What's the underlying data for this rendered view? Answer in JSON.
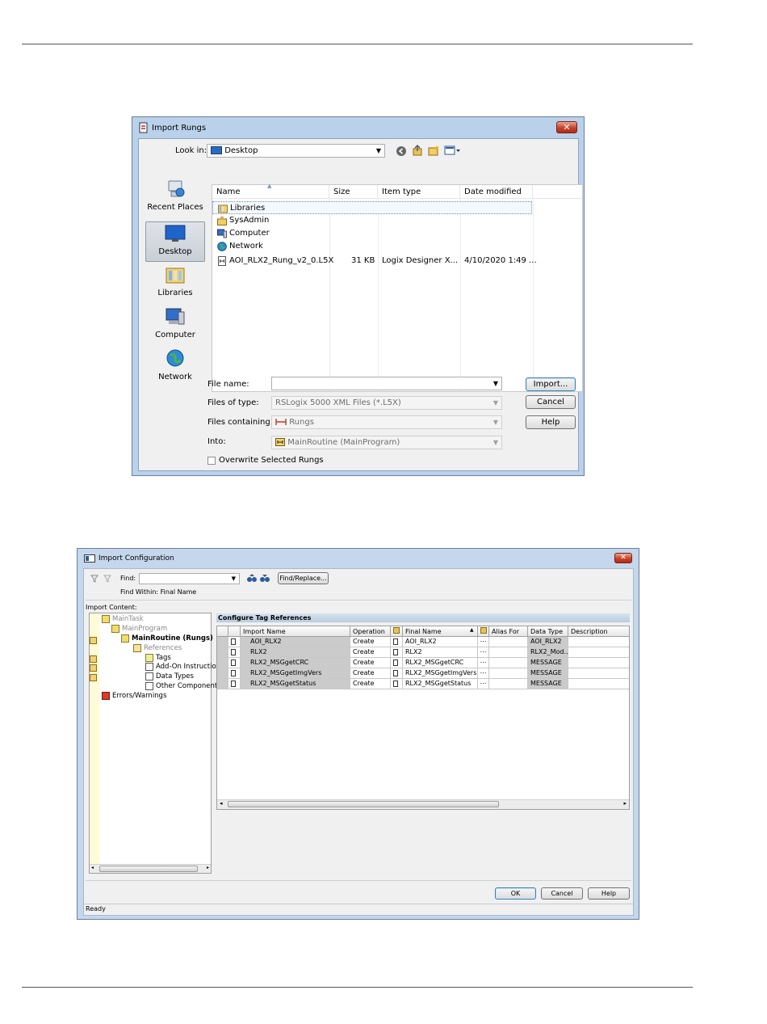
{
  "import_rungs": {
    "title": "Import Rungs",
    "look_in_label": "Look in:",
    "look_in_value": "Desktop",
    "places": [
      {
        "label": "Recent Places",
        "icon": "recent-places-icon"
      },
      {
        "label": "Desktop",
        "icon": "desktop-icon",
        "selected": true
      },
      {
        "label": "Libraries",
        "icon": "libraries-icon"
      },
      {
        "label": "Computer",
        "icon": "computer-icon"
      },
      {
        "label": "Network",
        "icon": "network-icon"
      }
    ],
    "columns": [
      "Name",
      "Size",
      "Item type",
      "Date modified"
    ],
    "files": [
      {
        "name": "Libraries",
        "size": "",
        "type": "",
        "date": "",
        "icon": "libraries-icon"
      },
      {
        "name": "SysAdmin",
        "size": "",
        "type": "",
        "date": "",
        "icon": "user-folder-icon"
      },
      {
        "name": "Computer",
        "size": "",
        "type": "",
        "date": "",
        "icon": "computer-icon"
      },
      {
        "name": "Network",
        "size": "",
        "type": "",
        "date": "",
        "icon": "network-icon"
      },
      {
        "name": "AOI_RLX2_Rung_v2_0.L5X",
        "size": "31 KB",
        "type": "Logix Designer X...",
        "date": "4/10/2020 1:49 ...",
        "icon": "l5x-file-icon"
      }
    ],
    "file_name_label": "File name:",
    "file_name_value": "",
    "files_of_type_label": "Files of type:",
    "files_of_type_value": "RSLogix 5000 XML Files (*.L5X)",
    "files_containing_label": "Files containing:",
    "files_containing_value": "Rungs",
    "into_label": "Into:",
    "into_value": "MainRoutine (MainProgram)",
    "overwrite_label": "Overwrite Selected Rungs",
    "buttons": {
      "import": "Import...",
      "cancel": "Cancel",
      "help": "Help"
    }
  },
  "import_config": {
    "title": "Import Configuration",
    "find_label": "Find:",
    "find_value": "",
    "find_within": "Find Within: Final Name",
    "find_replace": "Find/Replace...",
    "import_content_label": "Import Content:",
    "tree": [
      {
        "label": "MainTask"
      },
      {
        "label": "MainProgram"
      },
      {
        "label": "MainRoutine (Rungs)"
      },
      {
        "label": "References"
      },
      {
        "label": "Tags"
      },
      {
        "label": "Add-On Instructio"
      },
      {
        "label": "Data Types"
      },
      {
        "label": "Other Components"
      },
      {
        "label": "Errors/Warnings"
      }
    ],
    "section_title": "Configure Tag References",
    "columns": [
      "Import Name",
      "Operation",
      "Final Name",
      "Alias For",
      "Data Type",
      "Description"
    ],
    "rows": [
      {
        "import_name": "AOI_RLX2",
        "operation": "Create",
        "final_name": "AOI_RLX2",
        "alias": "",
        "data_type": "AOI_RLX2",
        "description": ""
      },
      {
        "import_name": "RLX2",
        "operation": "Create",
        "final_name": "RLX2",
        "alias": "",
        "data_type": "RLX2_Mod...",
        "description": ""
      },
      {
        "import_name": "RLX2_MSGgetCRC",
        "operation": "Create",
        "final_name": "RLX2_MSGgetCRC",
        "alias": "",
        "data_type": "MESSAGE",
        "description": ""
      },
      {
        "import_name": "RLX2_MSGgetImgVers",
        "operation": "Create",
        "final_name": "RLX2_MSGgetImgVers",
        "alias": "",
        "data_type": "MESSAGE",
        "description": ""
      },
      {
        "import_name": "RLX2_MSGgetStatus",
        "operation": "Create",
        "final_name": "RLX2_MSGgetStatus",
        "alias": "",
        "data_type": "MESSAGE",
        "description": ""
      }
    ],
    "buttons": {
      "ok": "OK",
      "cancel": "Cancel",
      "help": "Help"
    },
    "status": "Ready"
  }
}
